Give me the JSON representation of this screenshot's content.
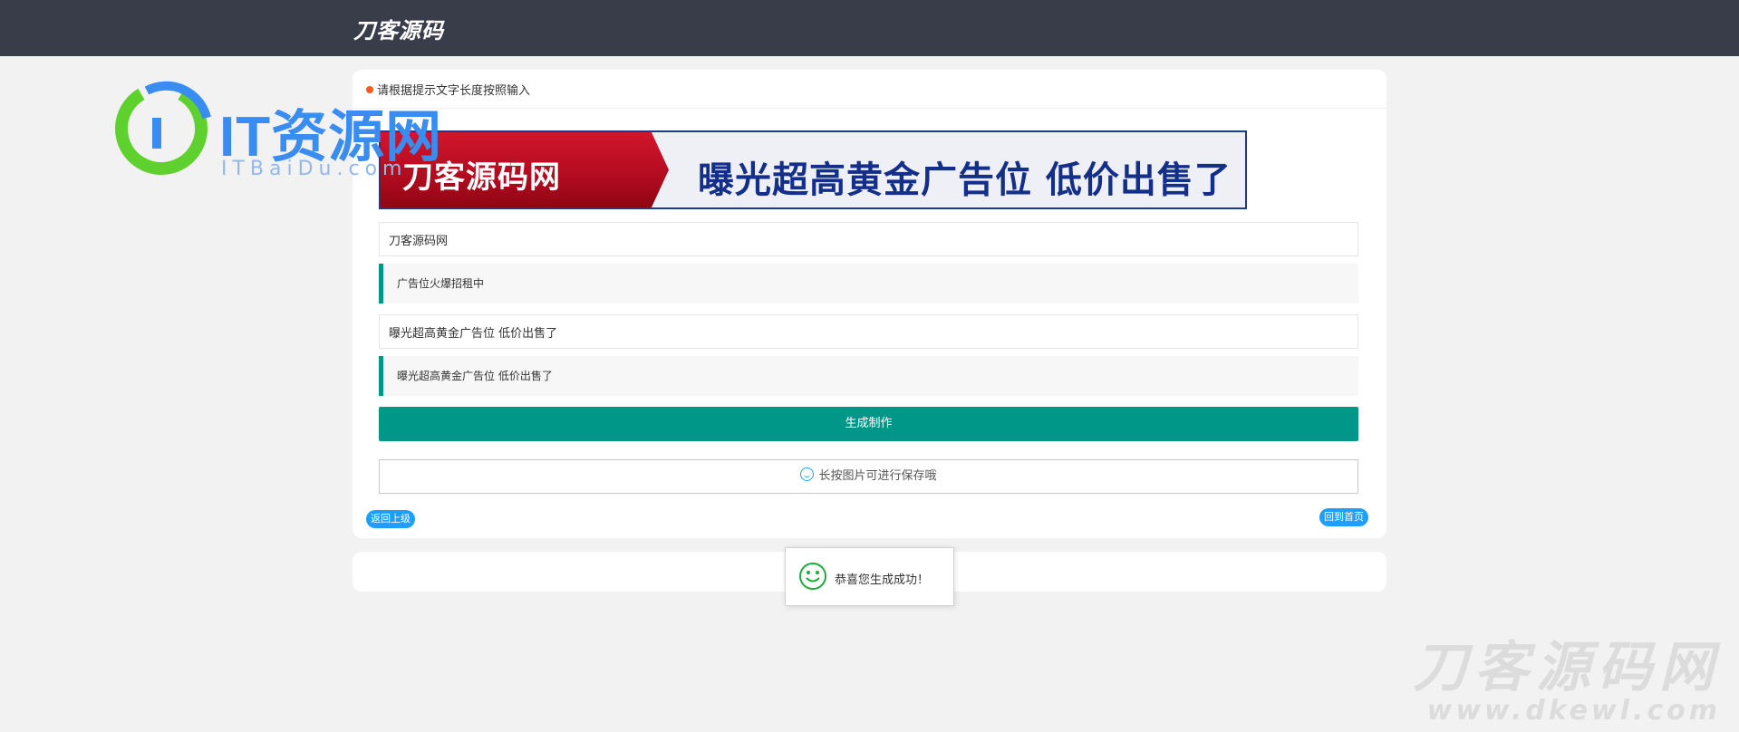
{
  "topbar": {
    "brand": "刀客源码"
  },
  "form": {
    "hint": "请根据提示文字长度按照输入",
    "banner": {
      "left_text": "刀客源码网",
      "right_text": "曝光超高黄金广告位 低价出售了"
    },
    "field1_value": "刀客源码网",
    "field1_note": "广告位火爆招租中",
    "field2_value": "曝光超高黄金广告位 低价出售了",
    "field2_note": "曝光超高黄金广告位 低价出售了",
    "generate_label": "生成制作",
    "save_tip": "长按图片可进行保存哦",
    "back_label": "返回上级",
    "home_label": "回到首页"
  },
  "toast": {
    "message": "恭喜您生成成功！",
    "icon": "smile-icon"
  },
  "overlay_logo": {
    "word": "IT资源网",
    "sub": "ITBaiDu.com"
  },
  "watermark": {
    "title": "刀客源码网",
    "url": "www.dkewl.com"
  },
  "colors": {
    "topbar": "#393d49",
    "accent": "#009688",
    "pill": "#1e9fff",
    "dot": "#ff5722"
  }
}
